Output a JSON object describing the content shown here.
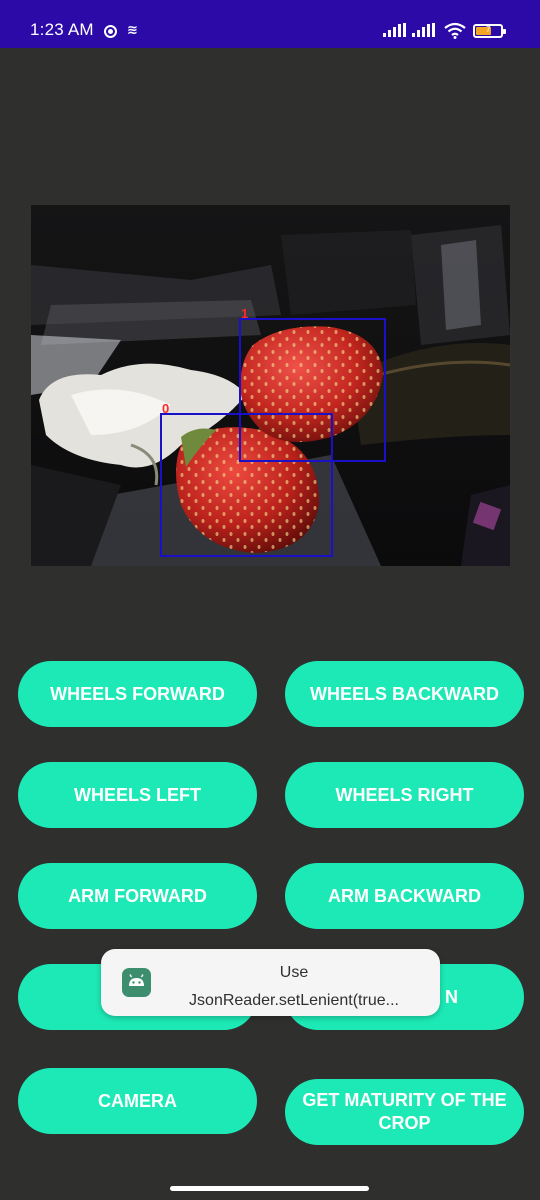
{
  "status_bar": {
    "time": "1:23 AM",
    "battery_level": "7",
    "background_color": "#2b0aa8",
    "icons": [
      "screen-record-icon",
      "notification-icon",
      "cellular-signal-icon",
      "cellular-signal-icon",
      "wifi-icon",
      "battery-icon"
    ]
  },
  "camera": {
    "detections": [
      {
        "label": "1"
      },
      {
        "label": "0"
      }
    ],
    "box_color": "#1a10c8",
    "label_color": "#ff2a2a"
  },
  "buttons": {
    "wheels_forward": "WHEELS FORWARD",
    "wheels_backward": "WHEELS BACKWARD",
    "wheels_left": "WHEELS LEFT",
    "wheels_right": "WHEELS RIGHT",
    "arm_forward": "ARM FORWARD",
    "arm_backward": "ARM BACKWARD",
    "row4_right_visible": "N",
    "camera": "CAMERA",
    "get_maturity": "GET MATURITY OF THE CROP",
    "color": "#1de9b6"
  },
  "toast": {
    "line1": "Use",
    "line2": "JsonReader.setLenient(true..."
  }
}
